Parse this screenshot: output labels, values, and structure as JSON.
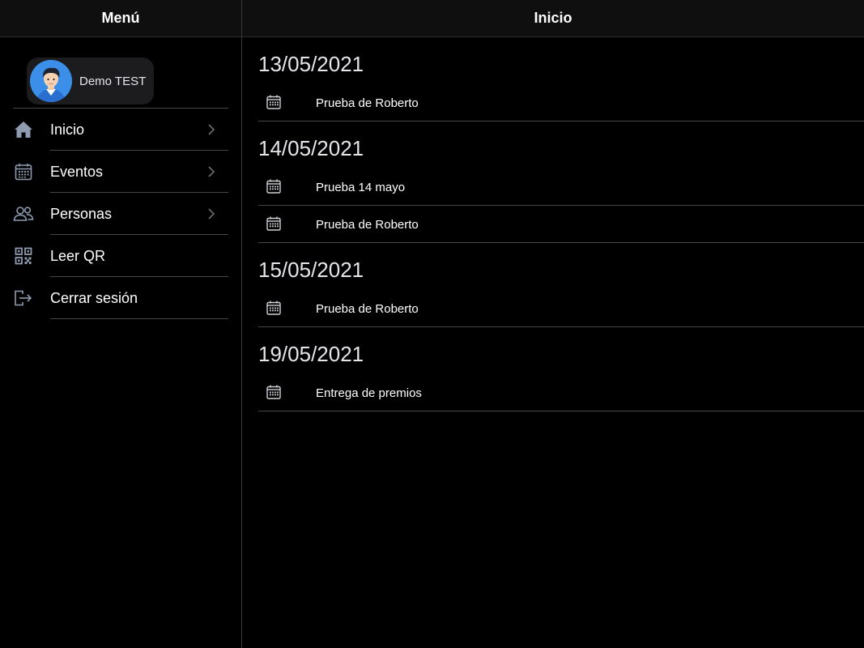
{
  "sidebar": {
    "title": "Menú",
    "profile": {
      "name": "Demo TEST"
    },
    "items": [
      {
        "label": "Inicio",
        "icon": "home-icon",
        "chevron": true
      },
      {
        "label": "Eventos",
        "icon": "calendar-icon",
        "chevron": true
      },
      {
        "label": "Personas",
        "icon": "people-icon",
        "chevron": true
      },
      {
        "label": "Leer QR",
        "icon": "qr-code-icon",
        "chevron": false
      },
      {
        "label": "Cerrar sesión",
        "icon": "logout-icon",
        "chevron": false
      }
    ]
  },
  "main": {
    "title": "Inicio",
    "groups": [
      {
        "date": "13/05/2021",
        "events": [
          "Prueba de Roberto"
        ]
      },
      {
        "date": "14/05/2021",
        "events": [
          "Prueba 14 mayo",
          "Prueba de Roberto"
        ]
      },
      {
        "date": "15/05/2021",
        "events": [
          "Prueba de Roberto"
        ]
      },
      {
        "date": "19/05/2021",
        "events": [
          "Entrega de premios"
        ]
      }
    ]
  },
  "colors": {
    "background": "#000000",
    "topbar": "#0f0f0f",
    "separator": "#48484a",
    "icon": "#8e9bb0",
    "avatar": "#3b8fe8"
  }
}
